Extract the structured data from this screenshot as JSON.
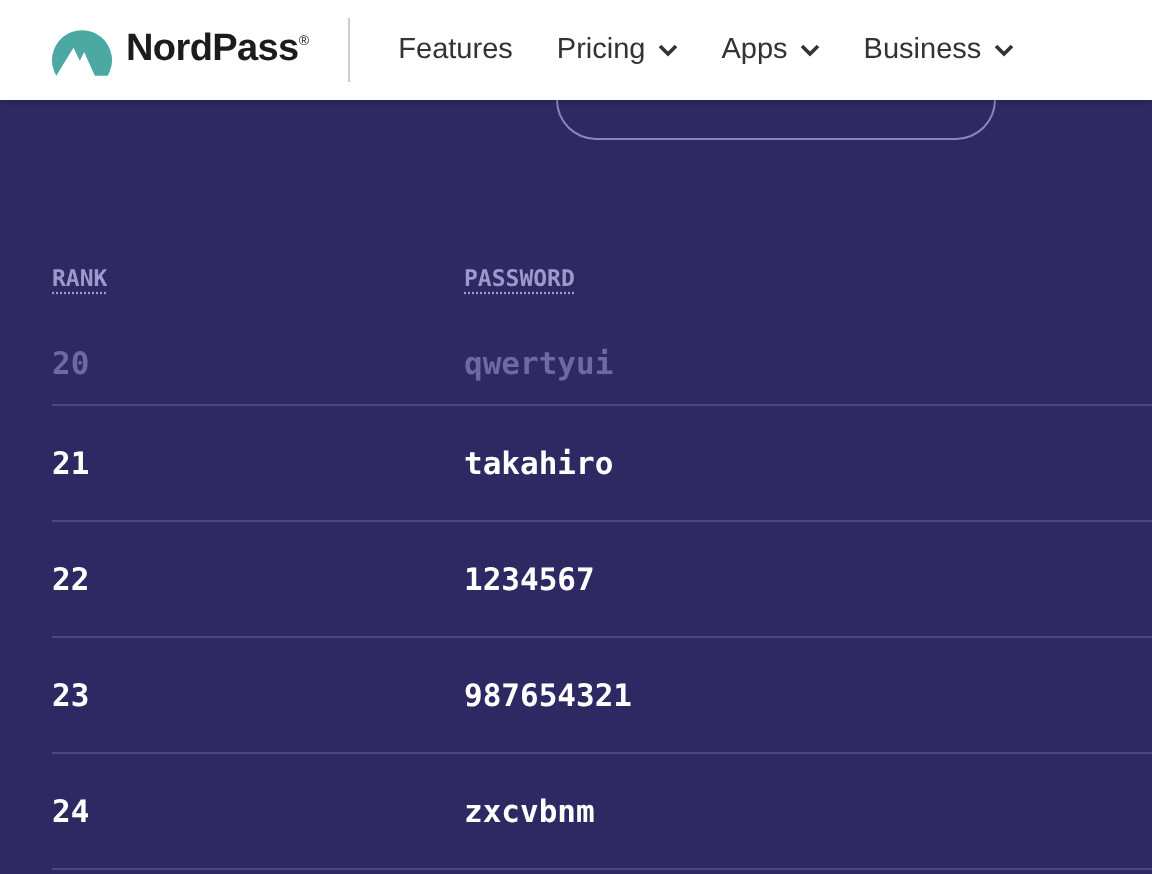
{
  "navbar": {
    "brand": "NordPass",
    "brand_mark": "®",
    "links": [
      {
        "label": "Features",
        "dropdown": false
      },
      {
        "label": "Pricing",
        "dropdown": true
      },
      {
        "label": "Apps",
        "dropdown": true
      },
      {
        "label": "Business",
        "dropdown": true
      }
    ]
  },
  "table": {
    "columns": [
      "RANK",
      "PASSWORD"
    ],
    "rows": [
      {
        "rank": "20",
        "password": "qwertyui",
        "dimmed": true
      },
      {
        "rank": "21",
        "password": "takahiro",
        "dimmed": false
      },
      {
        "rank": "22",
        "password": "1234567",
        "dimmed": false
      },
      {
        "rank": "23",
        "password": "987654321",
        "dimmed": false
      },
      {
        "rank": "24",
        "password": "zxcvbnm",
        "dimmed": false
      }
    ]
  }
}
